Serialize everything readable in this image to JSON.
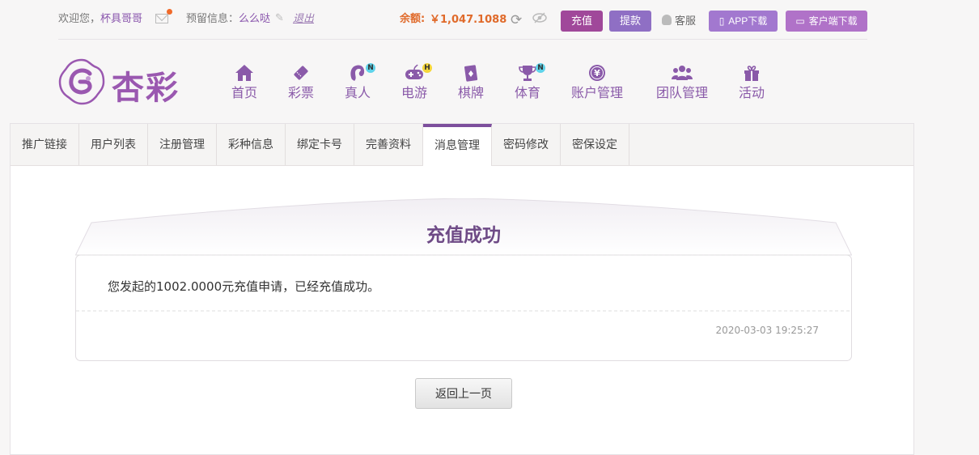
{
  "colors": {
    "accent": "#8a5aa9",
    "recharge": "#a0489a",
    "withdraw": "#8f6fc4",
    "balance": "#e06a2a",
    "active_tab": "#7d4f9d"
  },
  "topbar": {
    "welcome_prefix": "欢迎您，",
    "username": "杯具哥哥",
    "message_label": "预留信息：",
    "message_value": "么么哒",
    "logout": "退出",
    "balance_label": "余额:",
    "balance_value": "￥1,047.1088",
    "recharge_btn": "充值",
    "withdraw_btn": "提款",
    "service": "客服",
    "app_download": "APP下载",
    "client_download": "客户端下载",
    "icons": [
      "mail-icon",
      "edit-icon",
      "refresh-icon",
      "eye-hidden-icon",
      "service-icon",
      "phone-icon",
      "monitor-icon"
    ]
  },
  "logo": {
    "brand": "杏彩"
  },
  "nav": [
    {
      "label": "首页",
      "icon": "home-icon"
    },
    {
      "label": "彩票",
      "icon": "lottery-ticket-icon"
    },
    {
      "label": "真人",
      "icon": "live-dealer-icon",
      "badge": "N"
    },
    {
      "label": "电游",
      "icon": "gamepad-icon",
      "badge": "H"
    },
    {
      "label": "棋牌",
      "icon": "cards-icon"
    },
    {
      "label": "体育",
      "icon": "trophy-icon",
      "badge": "N"
    },
    {
      "label": "账户管理",
      "icon": "yen-coin-icon"
    },
    {
      "label": "团队管理",
      "icon": "team-icon"
    },
    {
      "label": "活动",
      "icon": "gift-icon"
    }
  ],
  "tabs": [
    {
      "label": "推广链接"
    },
    {
      "label": "用户列表"
    },
    {
      "label": "注册管理"
    },
    {
      "label": "彩种信息"
    },
    {
      "label": "绑定卡号"
    },
    {
      "label": "完善资料"
    },
    {
      "label": "消息管理",
      "active": true
    },
    {
      "label": "密码修改"
    },
    {
      "label": "密保设定"
    }
  ],
  "message": {
    "title": "充值成功",
    "body": "您发起的1002.0000元充值申请，已经充值成功。",
    "time": "2020-03-03 19:25:27"
  },
  "back_button": "返回上一页"
}
